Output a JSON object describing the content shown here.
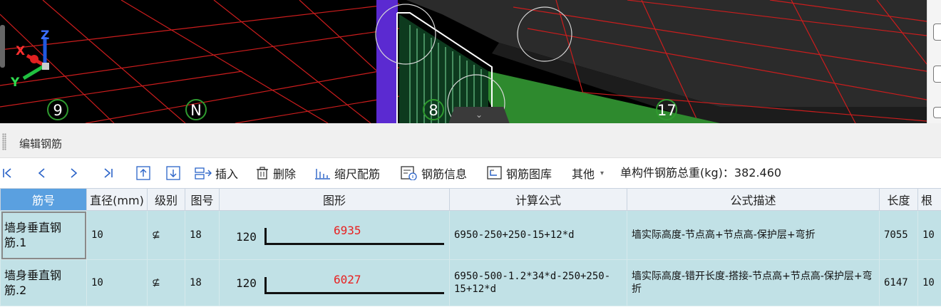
{
  "viewport": {
    "axes": {
      "x": "X",
      "y": "Y",
      "z": "Z"
    },
    "grid_labels": [
      "9",
      "N",
      "8",
      "17"
    ]
  },
  "panel": {
    "title": "编辑钢筋"
  },
  "toolbar": {
    "insert": "插入",
    "delete": "删除",
    "scale_rebar": "缩尺配筋",
    "rebar_info": "钢筋信息",
    "rebar_library": "钢筋图库",
    "other": "其他",
    "total_weight_label": "单构件钢筋总重(kg)：",
    "total_weight_value": "382.460"
  },
  "table": {
    "headers": {
      "name": "筋号",
      "diameter": "直径(mm)",
      "grade": "级别",
      "shape_no": "图号",
      "shape": "图形",
      "formula": "计算公式",
      "description": "公式描述",
      "length": "长度",
      "count": "根"
    },
    "rows": [
      {
        "name": "墙身垂直钢筋.1",
        "diameter": "10",
        "grade": "⊈",
        "shape_no": "18",
        "shape_left": "120",
        "shape_top": "6935",
        "formula": "6950-250+250-15+12*d",
        "description": "墙实际高度-节点高+节点高-保护层+弯折",
        "length": "7055",
        "count": "10"
      },
      {
        "name": "墙身垂直钢筋.2",
        "diameter": "10",
        "grade": "⊈",
        "shape_no": "18",
        "shape_left": "120",
        "shape_top": "6027",
        "formula": "6950-500-1.2*34*d-250+250-15+12*d",
        "description": "墙实际高度-错开长度-搭接-节点高+节点高-保护层+弯折",
        "length": "6147",
        "count": "10"
      }
    ]
  }
}
